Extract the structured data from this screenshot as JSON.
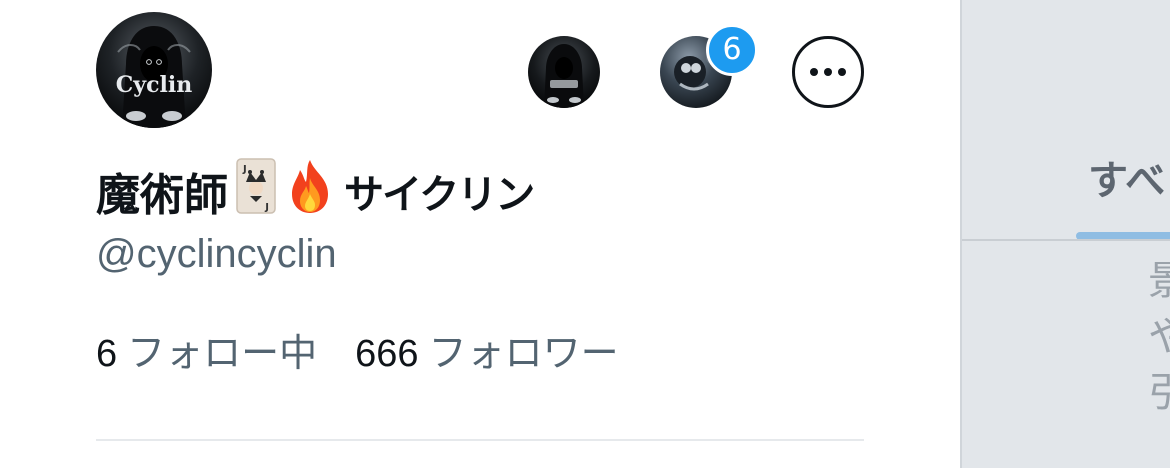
{
  "profile": {
    "avatar_icon": "hooded-figure-avatar-cyclin",
    "avatar_text": "Cyclin",
    "display_name": "魔術師",
    "display_name_suffix": "サイクリン",
    "emoji": [
      "joker-card-icon",
      "fire-icon"
    ],
    "handle": "@cyclincyclin"
  },
  "accounts": {
    "account1_icon": "account-avatar-icon",
    "account2_icon": "account-avatar-icon",
    "notification_count": "6",
    "more_icon": "more-options-icon"
  },
  "stats": {
    "following_count": "6",
    "following_label": "フォロー中",
    "followers_count": "666",
    "followers_label": "フォロワー"
  },
  "background_panel": {
    "tab_label": "すべ",
    "text_lines": [
      "景",
      "や",
      "引"
    ],
    "accent_color": "#8fbde3"
  },
  "colors": {
    "primary_text": "#0f1419",
    "secondary_text": "#536471",
    "badge": "#1d9bf0"
  }
}
